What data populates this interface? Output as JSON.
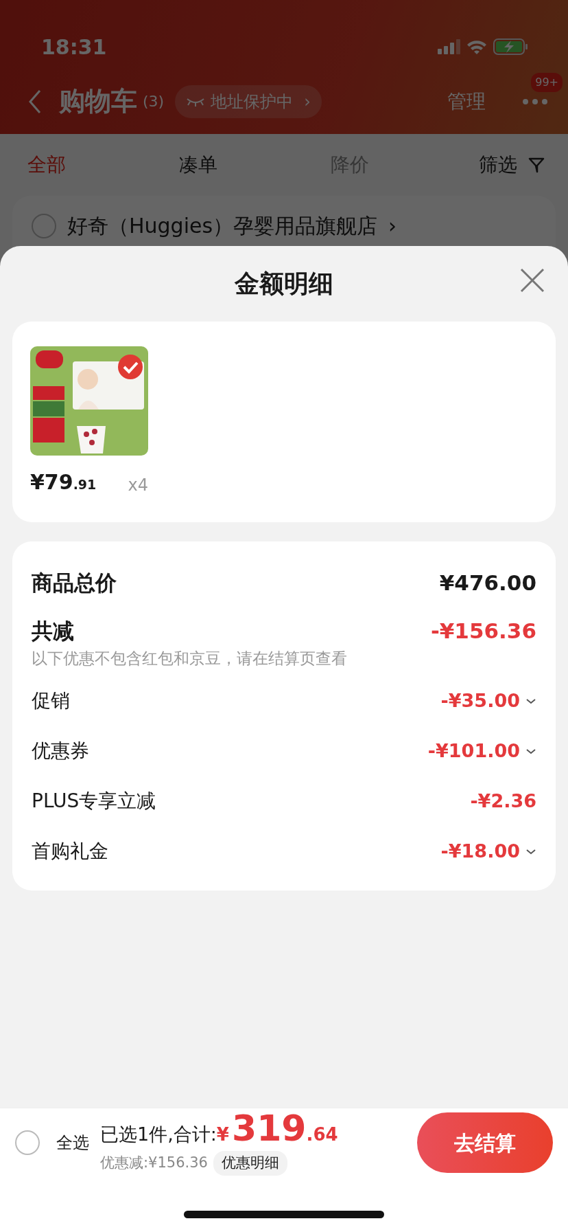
{
  "status_bar": {
    "time": "18:31"
  },
  "nav": {
    "title": "购物车",
    "count": "(3)",
    "address_badge": "地址保护中",
    "address_chevron": "›",
    "manage": "管理",
    "more_badge": "99+"
  },
  "tabs": [
    {
      "label": "全部",
      "selected": true,
      "disabled": false
    },
    {
      "label": "凑单",
      "selected": false,
      "disabled": false
    },
    {
      "label": "降价",
      "selected": false,
      "disabled": true
    }
  ],
  "filter": {
    "label": "筛选"
  },
  "store": {
    "name": "好奇（Huggies）孕婴用品旗舰店",
    "chevron": "›",
    "checked": false
  },
  "sheet": {
    "title": "金额明细",
    "items": [
      {
        "kind": "picture",
        "currency": "¥",
        "price_int": "79",
        "price_dec": ".91",
        "qty": "x4",
        "checked": true
      }
    ],
    "total": {
      "label": "商品总价",
      "value": "¥476.00"
    },
    "discount": {
      "label": "共减",
      "value": "-¥156.36",
      "note": "以下优惠不包含红包和京豆，请在结算页查看"
    },
    "breakdown": [
      {
        "label": "促销",
        "value": "-¥35.00",
        "expandable": true
      },
      {
        "label": "优惠券",
        "value": "-¥101.00",
        "expandable": true
      },
      {
        "label": "PLUS专享立减",
        "value": "-¥2.36",
        "expandable": false
      },
      {
        "label": "首购礼金",
        "value": "-¥18.00",
        "expandable": true
      }
    ]
  },
  "bottom_bar": {
    "select_all": {
      "label": "全选",
      "checked": false
    },
    "summary": "已选1件,合计:",
    "currency": "¥",
    "total_int": "319",
    "total_dec": ".64",
    "saved": "优惠减:¥156.36",
    "details_button": "优惠明细",
    "checkout_button": "去结算"
  }
}
